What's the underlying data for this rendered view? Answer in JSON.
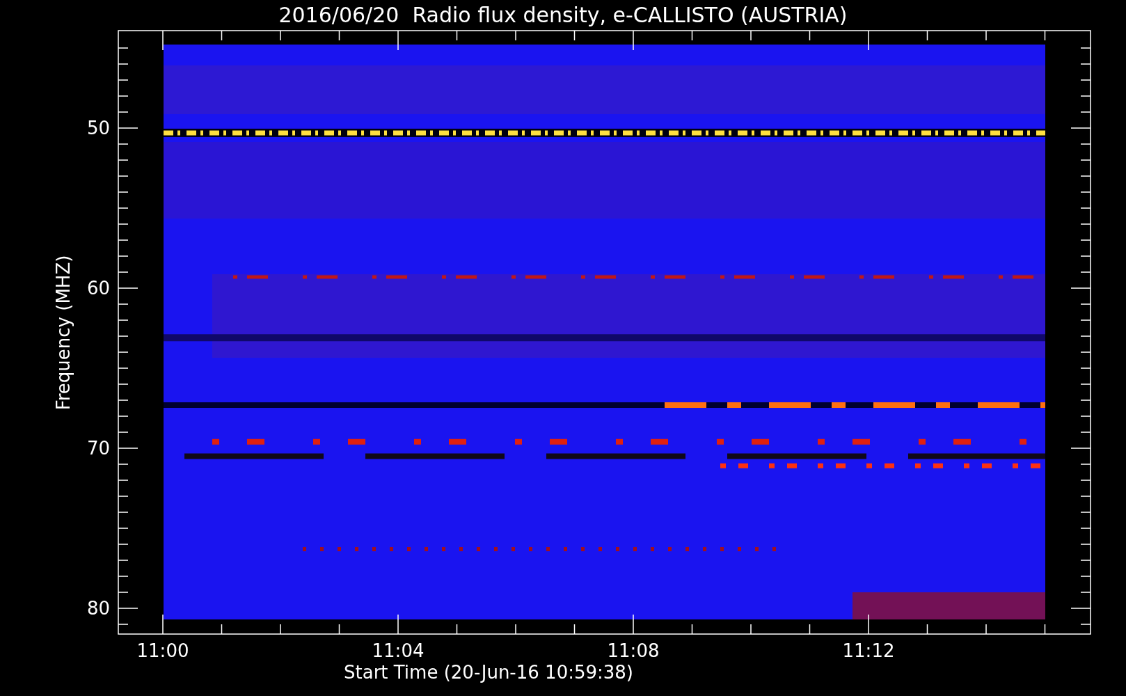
{
  "title": "2016/06/20  Radio flux density, e-CALLISTO (AUSTRIA)",
  "y_axis": {
    "label": "Frequency (MHZ)",
    "ticks": [
      "50",
      "60",
      "70",
      "80"
    ]
  },
  "x_axis": {
    "label": "Start Time (20-Jun-16 10:59:38)",
    "ticks": [
      "11:00",
      "11:04",
      "11:08",
      "11:12"
    ]
  }
}
